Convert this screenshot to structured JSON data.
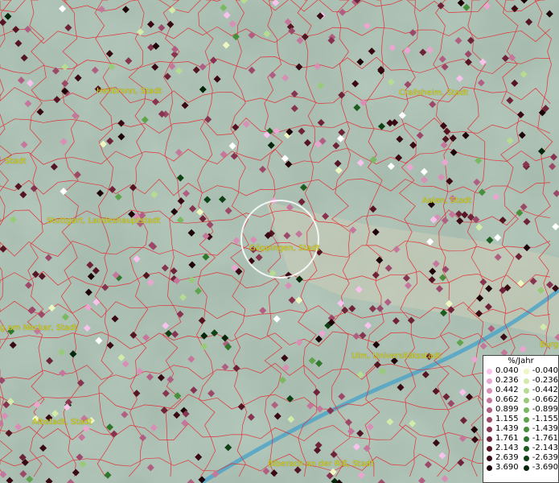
{
  "cities": [
    {
      "id": "heilbronn",
      "label": "Heilbronn, Stadt"
    },
    {
      "id": "crailsheim",
      "label": "Crailsheim, Stadt"
    },
    {
      "id": "stadt-left",
      "label": "Stadt"
    },
    {
      "id": "aalen",
      "label": "Aalen, Stadt"
    },
    {
      "id": "stuttgart",
      "label": "Stuttgart, Landeshauptstadt"
    },
    {
      "id": "goeppingen",
      "label": "Göppingen, Stadt"
    },
    {
      "id": "neckar",
      "label": "g am Neckar, Stadt"
    },
    {
      "id": "ulm",
      "label": "Ulm, Universitätsstadt"
    },
    {
      "id": "burg",
      "label": "Burg"
    },
    {
      "id": "albstadt",
      "label": "Albstadt, Stadt"
    },
    {
      "id": "biberach",
      "label": "Biberach an der Riß, Stadt"
    }
  ],
  "legend": {
    "title": "%/Jahr",
    "positive": [
      {
        "value": "0.040",
        "color": "#f7c2ec"
      },
      {
        "value": "0.236",
        "color": "#eaa6cf"
      },
      {
        "value": "0.442",
        "color": "#d88fb6"
      },
      {
        "value": "0.662",
        "color": "#c5779b"
      },
      {
        "value": "0.899",
        "color": "#b05f82"
      },
      {
        "value": "1.155",
        "color": "#9c4868"
      },
      {
        "value": "1.439",
        "color": "#86344f"
      },
      {
        "value": "1.761",
        "color": "#6e2338"
      },
      {
        "value": "2.143",
        "color": "#551523"
      },
      {
        "value": "2.639",
        "color": "#3a0a14"
      },
      {
        "value": "3.690",
        "color": "#1e0309"
      }
    ],
    "negative": [
      {
        "value": "-0.040",
        "color": "#eef7c2"
      },
      {
        "value": "-0.236",
        "color": "#d2ebaa"
      },
      {
        "value": "-0.442",
        "color": "#b6dc92"
      },
      {
        "value": "-0.662",
        "color": "#98cb79"
      },
      {
        "value": "-0.899",
        "color": "#7bb862"
      },
      {
        "value": "-1.155",
        "color": "#5fa44d"
      },
      {
        "value": "-1.439",
        "color": "#478f3b"
      },
      {
        "value": "-1.761",
        "color": "#2f772c"
      },
      {
        "value": "-2.143",
        "color": "#1c5d1f"
      },
      {
        "value": "-2.639",
        "color": "#0e4114"
      },
      {
        "value": "-3.690",
        "color": "#05260a"
      }
    ]
  }
}
